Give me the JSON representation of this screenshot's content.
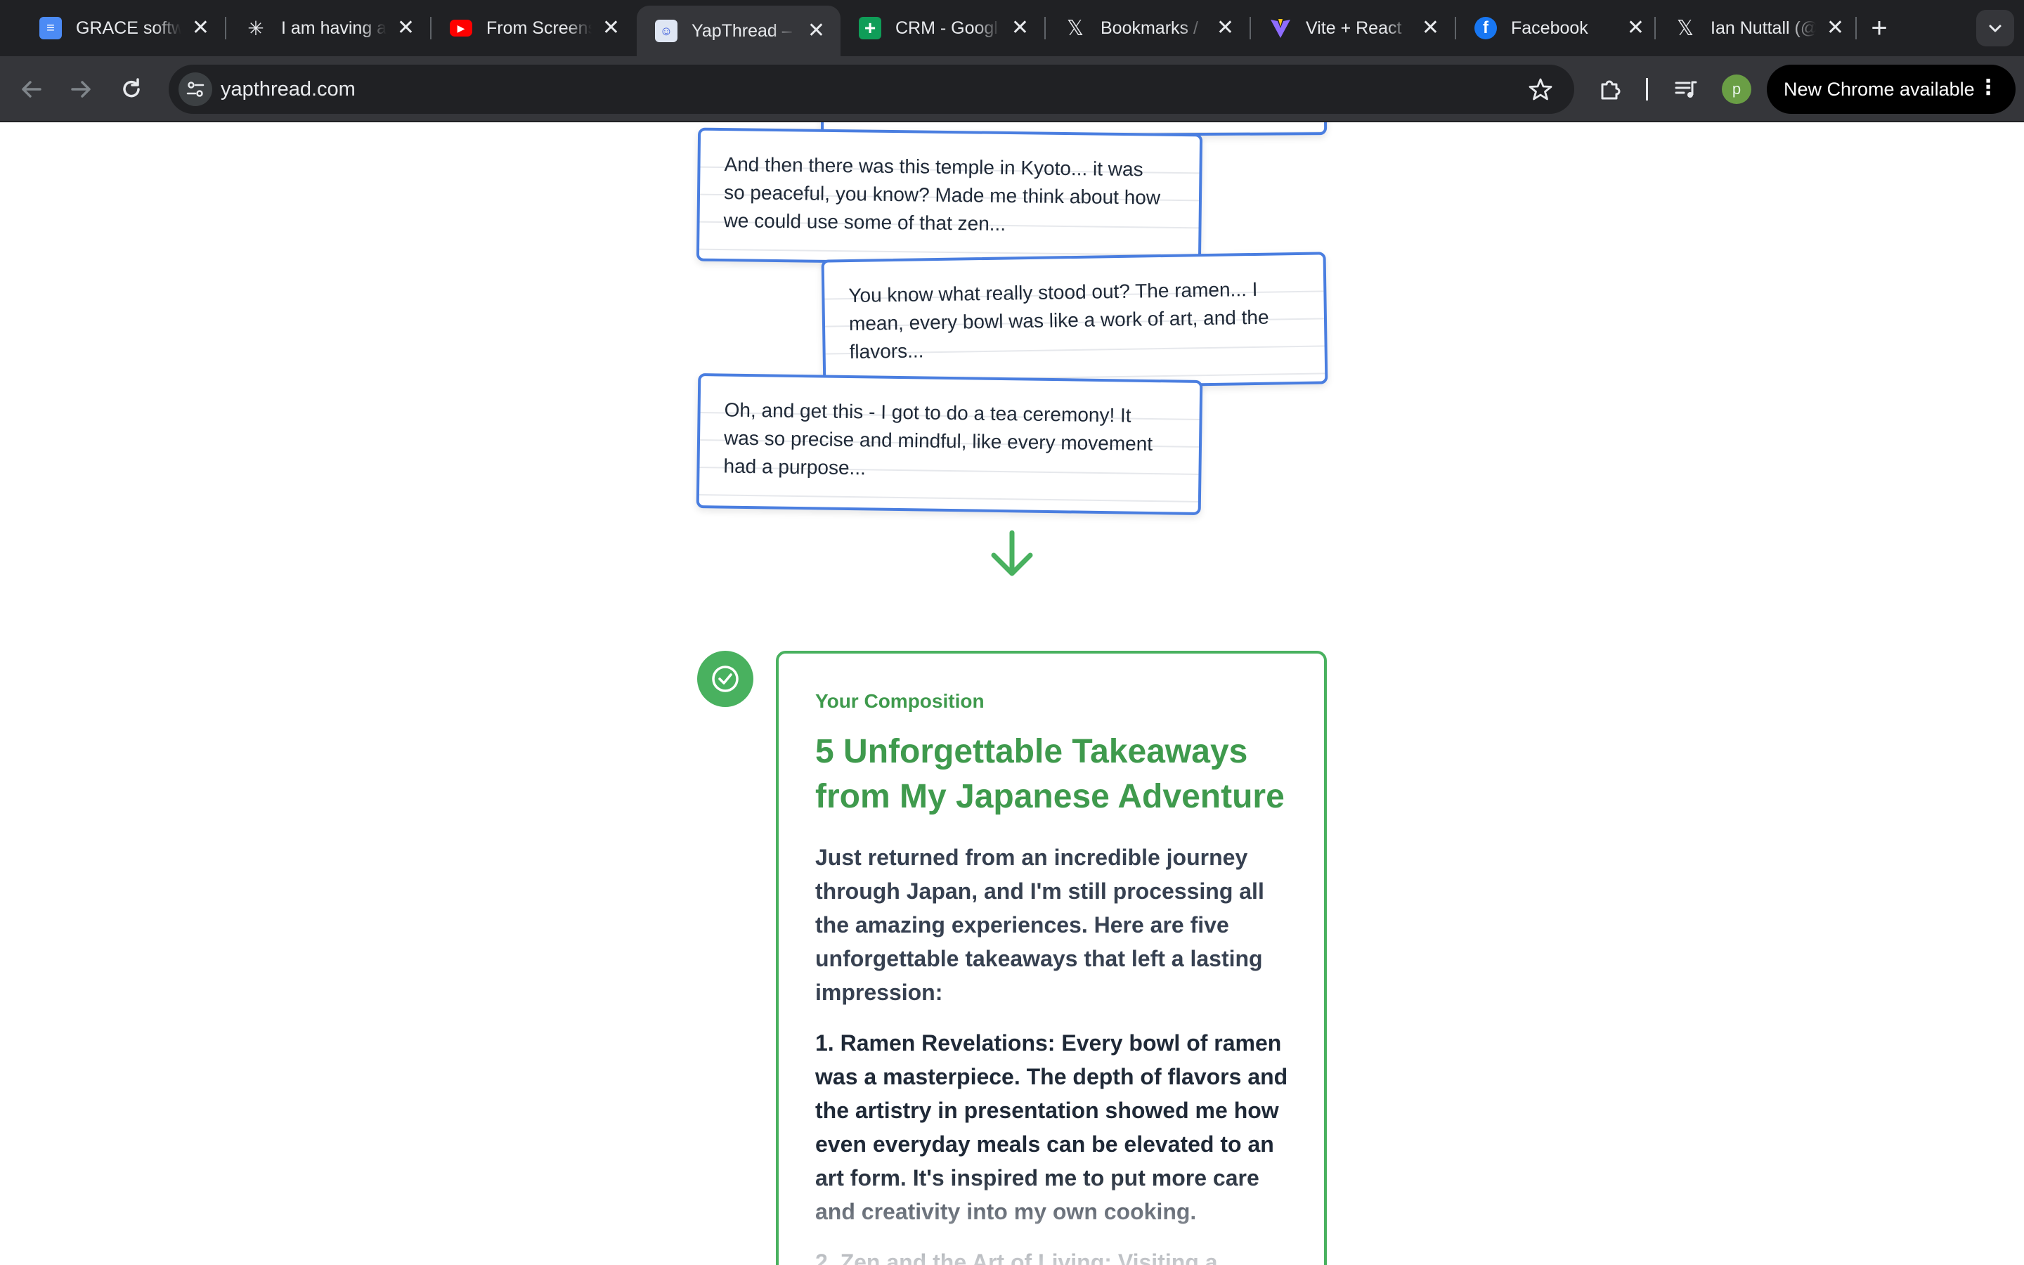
{
  "browser": {
    "tabs": [
      {
        "title": "GRACE softw",
        "icon": "google-docs-icon",
        "color": "#4c8bf5",
        "glyph": "≡"
      },
      {
        "title": "I am having a",
        "icon": "claude-icon",
        "color": "#202124",
        "glyph": "✳"
      },
      {
        "title": "From Screens",
        "icon": "youtube-icon",
        "color": "#ff0000",
        "glyph": "▶"
      },
      {
        "title": "YapThread –",
        "icon": "yapthread-icon",
        "color": "#e8eaed",
        "glyph": "☺"
      },
      {
        "title": "CRM - Googl",
        "icon": "google-sheets-icon",
        "color": "#0f9d58",
        "glyph": "+"
      },
      {
        "title": "Bookmarks /",
        "icon": "x-icon",
        "color": "#202124",
        "glyph": "𝕏"
      },
      {
        "title": "Vite + React",
        "icon": "vite-icon",
        "color": "#7c4dff",
        "glyph": "▼"
      },
      {
        "title": "Facebook",
        "icon": "facebook-icon",
        "color": "#1877f2",
        "glyph": "f"
      },
      {
        "title": "Ian Nuttall (@",
        "icon": "x-icon",
        "color": "#202124",
        "glyph": "𝕏"
      }
    ],
    "active_tab": 3,
    "close_glyph": "✕",
    "new_tab_glyph": "+",
    "url": "yapthread.com",
    "profile_initial": "p",
    "update_chip": "New Chrome available",
    "menu_glyph": "⋮"
  },
  "page": {
    "notes": [
      {
        "text": "And then there was this temple in Kyoto... it was\nso peaceful, you know? Made me think about how\nwe could use some of that zen..."
      },
      {
        "text": "You know what really stood out? The ramen... I\nmean, every bowl was like a work of art, and the\nflavors..."
      },
      {
        "text": "Oh, and get this - I got to do a tea ceremony! It\nwas so precise and mindful, like every movement\nhad a purpose..."
      }
    ],
    "composition": {
      "label": "Your Composition",
      "title": "5 Unforgettable Takeaways from My Japanese Adventure",
      "intro": "Just returned from an incredible journey through Japan, and I'm still processing all the amazing experiences. Here are five unforgettable takeaways that left a lasting impression:",
      "item1": "1. Ramen Revelations: Every bowl of ramen was a masterpiece. The depth of flavors and the artistry in presentation showed me how even everyday meals can be elevated to an art form. It's inspired me to put more care and creativity into my own cooking.",
      "item2": "2. Zen and the Art of Living: Visiting a"
    },
    "colors": {
      "note_border": "#4a7ee0",
      "accent_green": "#49b15f"
    }
  }
}
